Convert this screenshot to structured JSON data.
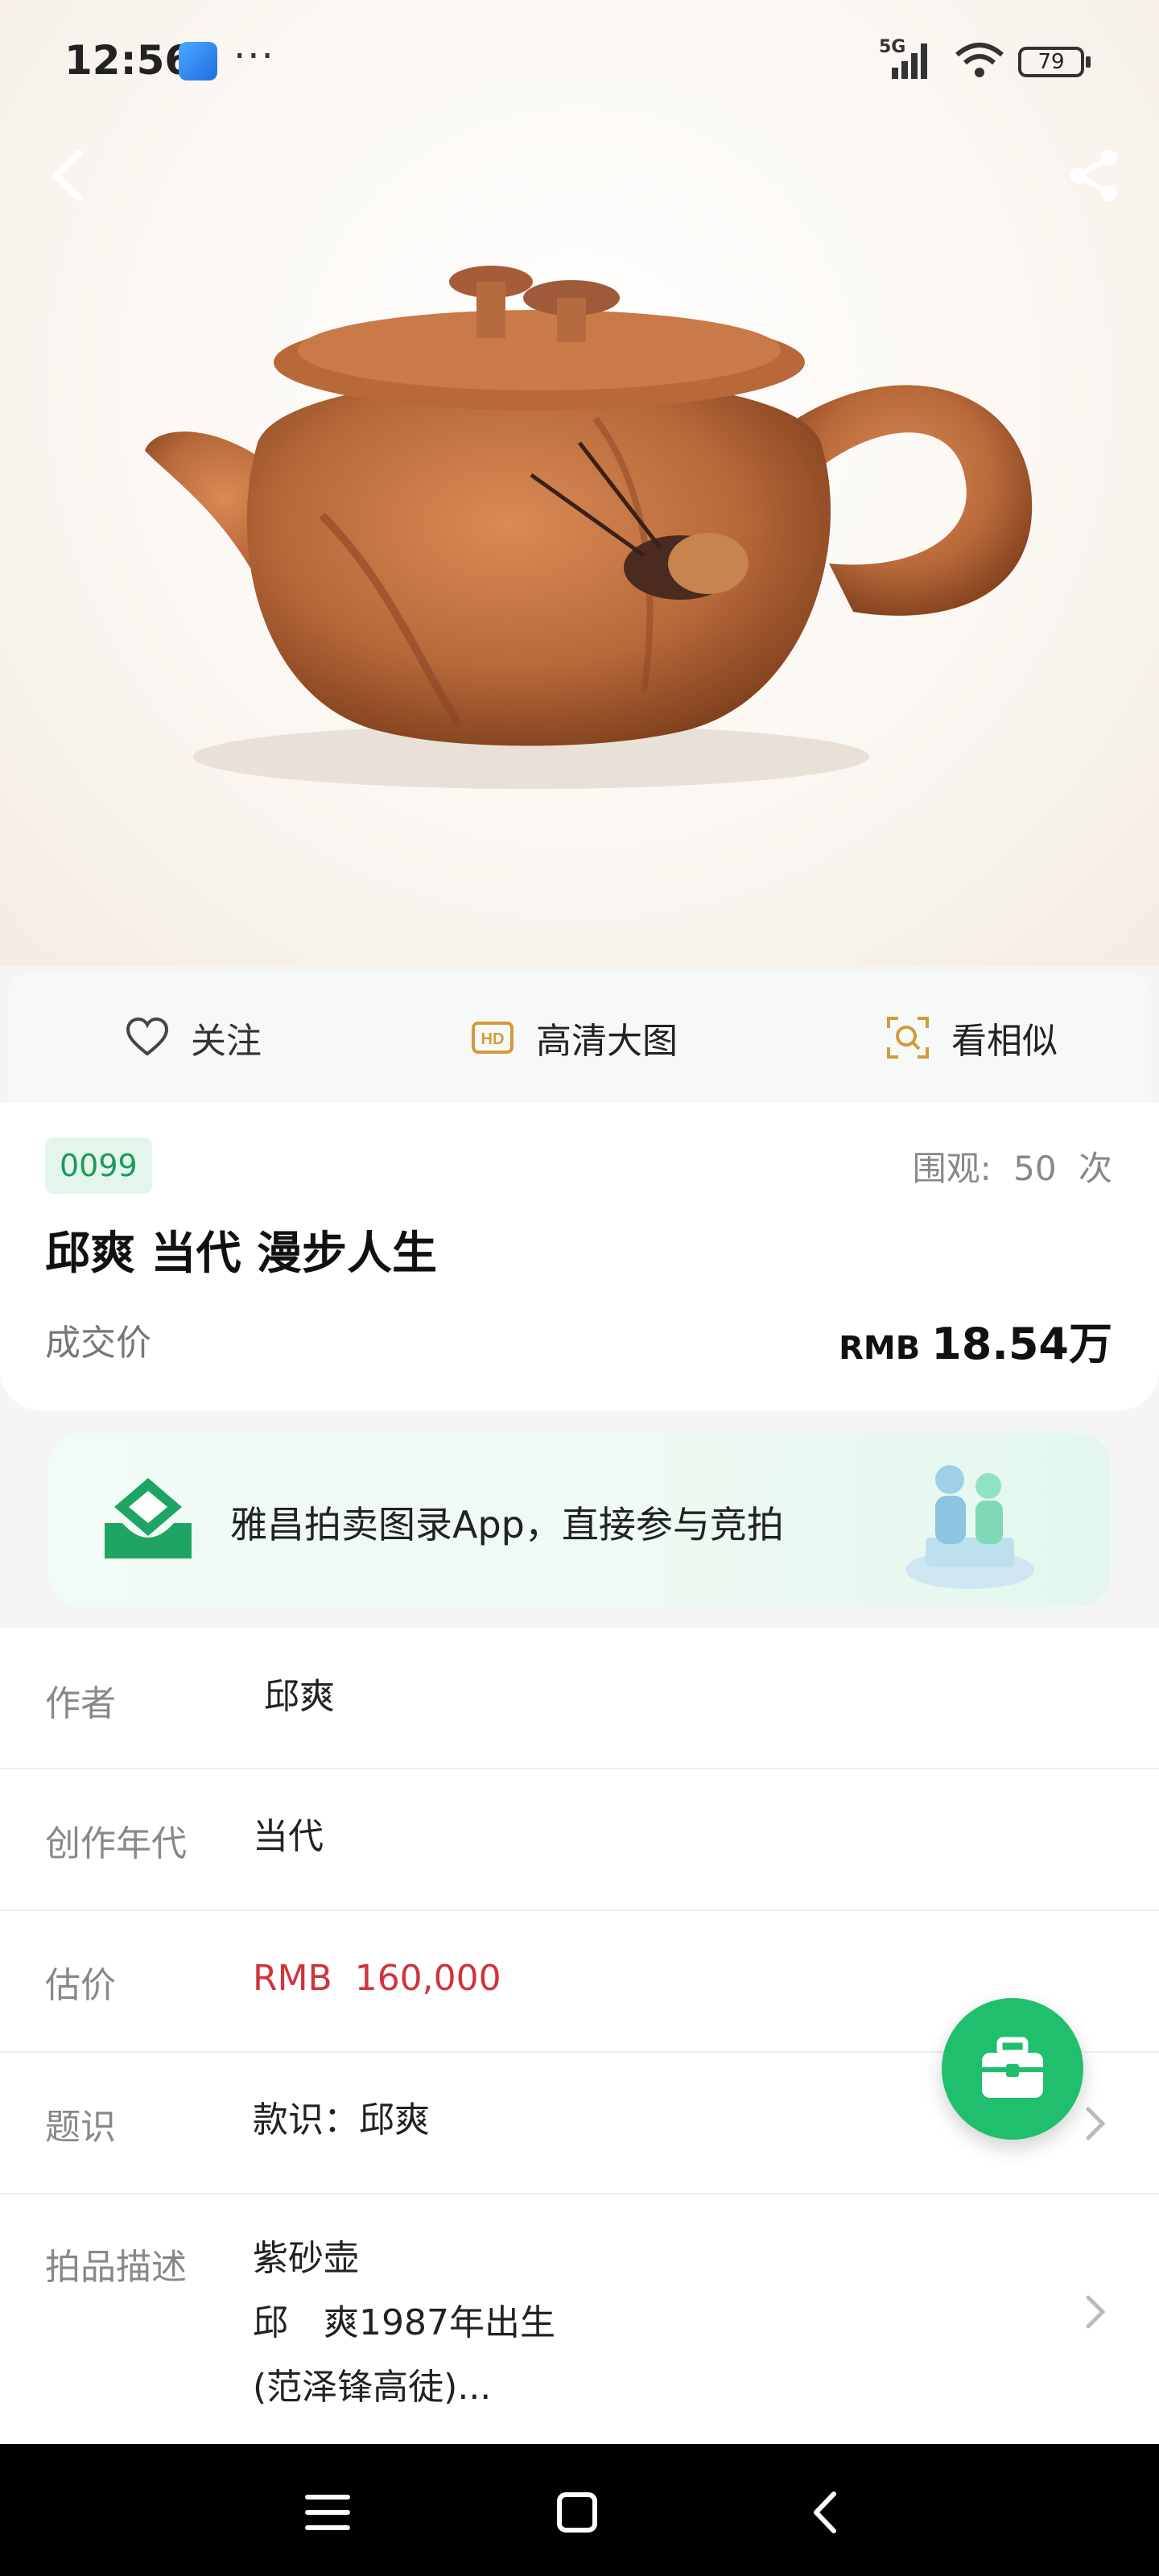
{
  "status_bar": {
    "time": "12:56",
    "more": "···",
    "network": "5G",
    "wifi_level": "6",
    "battery": "79"
  },
  "toolbar": {
    "back_icon": "chevron-left-icon",
    "share_icon": "share-icon"
  },
  "actions": {
    "follow": "关注",
    "hd_image": "高清大图",
    "similar": "看相似"
  },
  "lot": {
    "number": "0099",
    "views_label": "围观:",
    "views_count": "50",
    "views_unit": "次",
    "title": "邱爽 当代 漫步人生",
    "deal_label": "成交价",
    "deal_currency": "RMB",
    "deal_price": "18.54万"
  },
  "banner": {
    "text": "雅昌拍卖图录App，直接参与竞拍"
  },
  "details": [
    {
      "label": "作者",
      "value": "邱爽"
    },
    {
      "label": "创作年代",
      "value": "当代"
    },
    {
      "label": "估价",
      "value": "RMB  160,000"
    },
    {
      "label": "题识",
      "value": "款识：邱爽"
    },
    {
      "label": "拍品描述",
      "lines": [
        "紫砂壶",
        "邱　爽1987年出生",
        "(范泽锋高徒)..."
      ]
    }
  ],
  "colors": {
    "accent_green": "#1fbf6e",
    "price_red": "#d0333b",
    "lot_badge_bg": "#e4f5ec"
  }
}
